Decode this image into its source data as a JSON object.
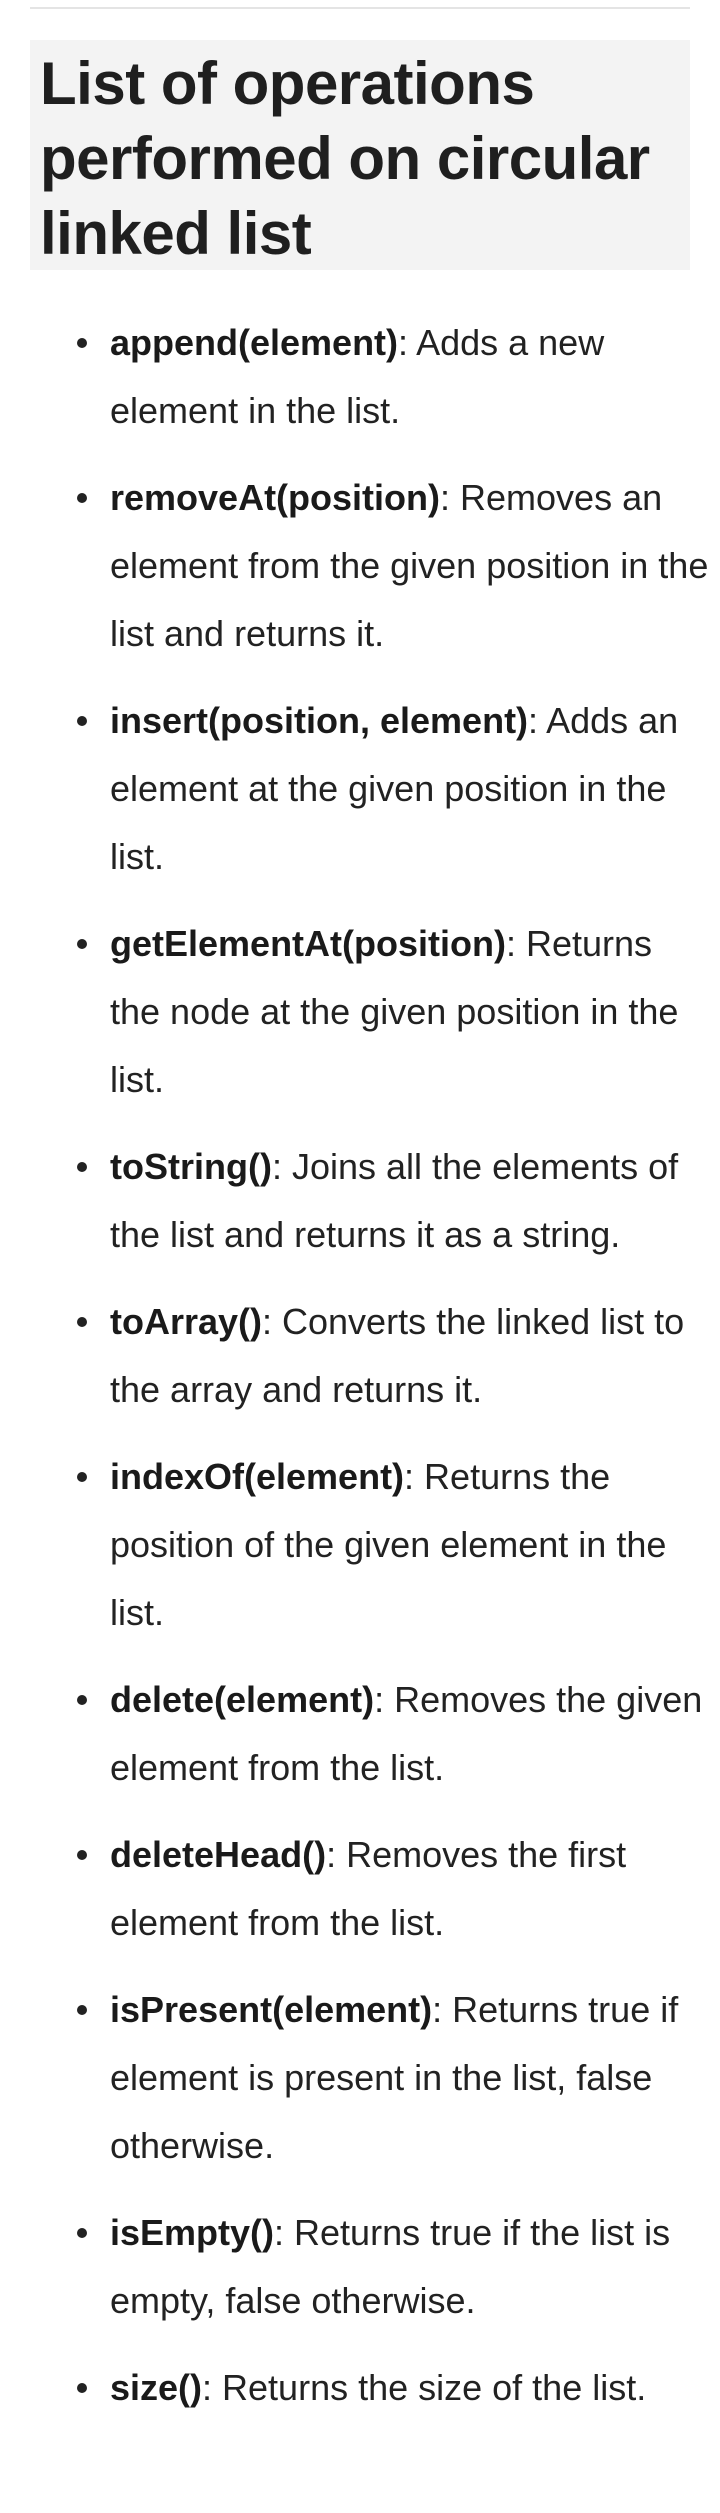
{
  "heading": "List of operations performed on circular linked list",
  "operations": [
    {
      "name": "append(element)",
      "desc": ": Adds a new element in the list."
    },
    {
      "name": "removeAt(position)",
      "desc": ": Removes an element from the given position in the list and returns it."
    },
    {
      "name": "insert(position, element)",
      "desc": ": Adds an element at the given position in the list."
    },
    {
      "name": "getElementAt(position)",
      "desc": ": Returns the node at the given position in the list."
    },
    {
      "name": "toString()",
      "desc": ": Joins all the elements of the list and returns it as a string."
    },
    {
      "name": "toArray()",
      "desc": ": Converts the linked list to the array and returns it."
    },
    {
      "name": "indexOf(element)",
      "desc": ": Returns the position of the given element in the list."
    },
    {
      "name": "delete(element)",
      "desc": ": Removes the given element from the list."
    },
    {
      "name": "deleteHead()",
      "desc": ": Removes the first element from the list."
    },
    {
      "name": "isPresent(element)",
      "desc": ": Returns true if element is present in the list, false otherwise."
    },
    {
      "name": "isEmpty()",
      "desc": ": Returns true if the list is empty, false otherwise."
    },
    {
      "name": "size()",
      "desc": ": Returns the size of the list."
    }
  ]
}
